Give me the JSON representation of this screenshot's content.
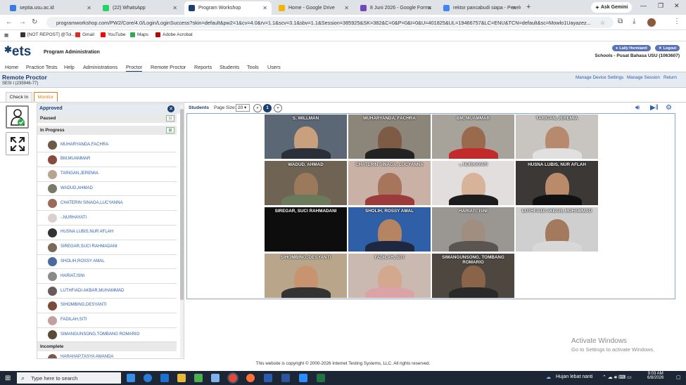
{
  "browser": {
    "tabs": [
      {
        "label": "septia.usu.ac.id",
        "color": "#3b7be0",
        "active": false
      },
      {
        "label": "(22) WhatsApp",
        "color": "#25d366",
        "active": false
      },
      {
        "label": "Program Workshop",
        "color": "#1b3f6e",
        "active": true
      },
      {
        "label": "Home - Google Drive",
        "color": "#f4b400",
        "active": false
      },
      {
        "label": "8 Juni 2026 - Google Forms",
        "color": "#7248b9",
        "active": false
      },
      {
        "label": "rektor pancabudi siapa - Penelu",
        "color": "#4285f4",
        "active": false
      }
    ],
    "new_tab": "+",
    "ask_gemini": "Ask Gemini",
    "url": "programworkshop.com/PW2/Core/4.0/Login/LoginSuccess?skin=default&pw2=1&cv=4.0&rv=1.1&scv=3.1&sbv=1.1&Session=385925&SK=382&C=0&P=0&I=0&U=401825&UL=19466757&LC=ENU&TCN=default&sc=Mowlo1Uayazez...",
    "bookmarks": [
      {
        "label": "[NOT REPOST] @Tol...",
        "color": "#333"
      },
      {
        "label": "Gmail",
        "color": "#d93025"
      },
      {
        "label": "YouTube",
        "color": "#ff0000"
      },
      {
        "label": "Maps",
        "color": "#34a853"
      },
      {
        "label": "Adobe Acrobat",
        "color": "#b30b00"
      }
    ]
  },
  "header": {
    "logo": "ets",
    "program": "Program Administration",
    "user": "Laily Hermianti",
    "logout": "Logout",
    "school": "Schools - Pusat Bahasa USU (1063607)"
  },
  "menu": [
    "Home",
    "Practice Tests",
    "Help",
    "Administrations",
    "Proctor",
    "Remote Proctor",
    "Reports",
    "Students",
    "Tools",
    "Users"
  ],
  "remote": {
    "title": "Remote Proctor",
    "session": "SESI I (235946-77)",
    "links": [
      "Manage Device Settings",
      "Manage Session",
      "Return"
    ]
  },
  "panel_tabs": [
    "Check In",
    "Monitor"
  ],
  "left": {
    "title": "Approved",
    "paused": "Paused",
    "in_progress": "In Progress",
    "incomplete": "Incomplete",
    "students": [
      {
        "name": "MUHARYANDA,FACHRA",
        "av": "#6b5a4a"
      },
      {
        "name": "BM,MUAMMAR",
        "av": "#8a4a3a"
      },
      {
        "name": "TARIGAN,JEREMIA",
        "av": "#b7a48f"
      },
      {
        "name": "WADUD,AHMAD",
        "av": "#7a7a6a"
      },
      {
        "name": "CHATERIN SINAGA,LUCYANNA",
        "av": "#9a6a5a"
      },
      {
        "name": "-,NURHAYATI",
        "av": "#d9d0d0"
      },
      {
        "name": "HUSNA LUBIS,NUR AFLAH",
        "av": "#333"
      },
      {
        "name": "SIREGAR,SUCI RAHMADANI",
        "av": "#7a6a5a"
      },
      {
        "name": "SHOLIH,ROSSY AMAL",
        "av": "#4a6aa0"
      },
      {
        "name": "HARIAT,ISNI",
        "av": "#8a8a8a"
      },
      {
        "name": "LUTHFIADI AKBAR,MUHAMMAD",
        "av": "#6a5a5a"
      },
      {
        "name": "SIHOMBING,DESYANTI",
        "av": "#7a4a3a"
      },
      {
        "name": "FADILAH,SITI",
        "av": "#c0a0a0"
      },
      {
        "name": "SIMANGUNSONG,TOMBANG ROMARIO",
        "av": "#5a4a3a"
      }
    ],
    "incomplete_first": "HARAHAP,TASYA AMANDA"
  },
  "toolbar": {
    "students": "Students",
    "page_size": "Page Size:",
    "page_size_value": "20",
    "prev": "«",
    "next": "»",
    "page": "1"
  },
  "tiles": [
    {
      "label": "S, WILLMAN",
      "bg": "#5c6775",
      "face": "#c9a07e",
      "body": "#2a2f3a"
    },
    {
      "label": "MUHARYANDA, FACHRA",
      "bg": "#8b857a",
      "face": "#7d5b44",
      "body": "#222"
    },
    {
      "label": "BM, MUAMMAR",
      "bg": "#a7a29a",
      "face": "#9a6a4f",
      "body": "#c22b2b"
    },
    {
      "label": "TARIGAN, JEREMIA",
      "bg": "#c8c4bf",
      "face": "#b88a6d",
      "body": "#e0e0e0"
    },
    {
      "label": "WADUD, AHMAD",
      "bg": "#6f6453",
      "face": "#9a7a5a",
      "body": "#6a7a5a"
    },
    {
      "label": "CHATERIN SINAGA, LUCYANNA",
      "bg": "#c9b1a5",
      "face": "#a7755c",
      "body": "#9b3b3b"
    },
    {
      "label": "-, NURHAYATI",
      "bg": "#e2dede",
      "face": "#d7b399",
      "body": "#1c1c1c"
    },
    {
      "label": "HUSNA LUBIS, NUR AFLAH",
      "bg": "#3c3836",
      "face": "#b98b6b",
      "body": "#111"
    },
    {
      "label": "SIREGAR, SUCI RAHMADANI",
      "bg": "#0d0d0d",
      "face": "#0d0d0d",
      "body": "#0d0d0d"
    },
    {
      "label": "SHOLIH, ROSSY AMAL",
      "bg": "#2f5fa6",
      "face": "#b58462",
      "body": "#1e2840"
    },
    {
      "label": "HARIATI, ISNI",
      "bg": "#9a9792",
      "face": "#a08f80",
      "body": "#5a5550"
    },
    {
      "label": "LUTHFIADI AKBAR, MUHAMMAD",
      "bg": "#cfcfcf",
      "face": "#a37a5d",
      "body": "#d8d8d8"
    },
    {
      "label": "SIHOMBING, DESYANTI",
      "bg": "#b9a58a",
      "face": "#c89470",
      "body": "#333"
    },
    {
      "label": "FADILAH, SITI",
      "bg": "#c9b9b0",
      "face": "#d4a88e",
      "body": "#d9a3a8"
    },
    {
      "label": "SIMANGUNSONG, TOMBANG ROMARIO",
      "bg": "#4e4740",
      "face": "#8a6448",
      "body": "#2a2a2a"
    }
  ],
  "footer": "This website is copyright © 2000-2026 Internet Testing Systems, LLC. All rights reserved.",
  "watermark": {
    "line1": "Activate Windows",
    "line2": "Go to Settings to activate Windows."
  },
  "taskbar": {
    "search": "Type here to search",
    "weather": "Hujan lebat nanti",
    "time": "9:03 AM",
    "date": "6/8/2026"
  }
}
